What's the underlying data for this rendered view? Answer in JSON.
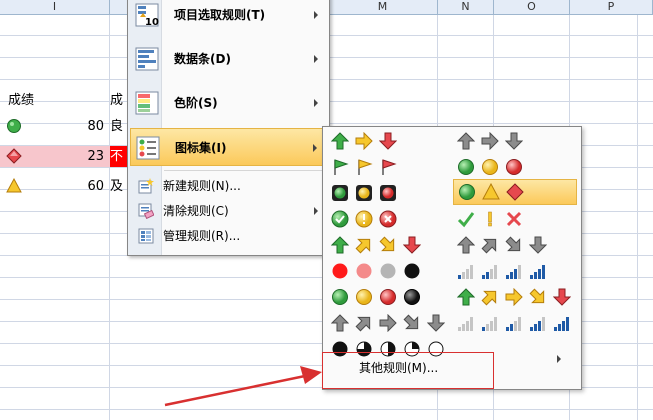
{
  "columns": [
    "I",
    "M",
    "N",
    "O",
    "P"
  ],
  "cells": {
    "header_score": "成绩",
    "header_partial": "成",
    "row1_value": "80",
    "row1_grade": "良",
    "row2_value": "23",
    "row2_grade": "不",
    "row3_value": "60",
    "row3_grade": "及"
  },
  "colors": {
    "highlight_row": "#f7c6cc",
    "red_cell": "#ff0000",
    "menu_highlight": "#fbc95a",
    "annotation_red": "#d83030"
  },
  "main_menu": {
    "items": [
      {
        "label": "项目选取规则(T)",
        "icon": "top-bottom-rules-icon"
      },
      {
        "label": "数据条(D)",
        "icon": "data-bars-icon"
      },
      {
        "label": "色阶(S)",
        "icon": "color-scales-icon"
      },
      {
        "label": "图标集(I)",
        "icon": "icon-sets-icon"
      }
    ],
    "small_items": [
      {
        "label": "新建规则(N)...",
        "icon": "new-rule-icon"
      },
      {
        "label": "清除规则(C)",
        "icon": "clear-rules-icon"
      },
      {
        "label": "管理规则(R)...",
        "icon": "manage-rules-icon"
      }
    ]
  },
  "submenu": {
    "more_rules": "其他规则(M)...",
    "highlighted_set": "3-signs-symbols"
  },
  "icon_sets_left": [
    {
      "name": "3-arrows-colored",
      "icons": [
        "arrow-up-green",
        "arrow-right-yellow",
        "arrow-down-red"
      ]
    },
    {
      "name": "3-flags",
      "icons": [
        "flag-green",
        "flag-yellow",
        "flag-red"
      ]
    },
    {
      "name": "3-traffic-lights-rimmed",
      "icons": [
        "light-green",
        "light-yellow",
        "light-red"
      ]
    },
    {
      "name": "3-symbols-circled",
      "icons": [
        "check-circle",
        "exclaim-circle",
        "x-circle"
      ]
    },
    {
      "name": "4-arrows-colored",
      "icons": [
        "arrow-up-green",
        "arrow-ne-yellow",
        "arrow-se-yellow",
        "arrow-down-red"
      ]
    },
    {
      "name": "red-to-black",
      "icons": [
        "dot-red",
        "dot-pink",
        "dot-gray",
        "dot-black"
      ]
    },
    {
      "name": "4-traffic-lights",
      "icons": [
        "dot-green",
        "dot-yellow",
        "dot-red",
        "dot-black"
      ]
    },
    {
      "name": "5-arrows-gray",
      "icons": [
        "arrow-up-gray",
        "arrow-ne-gray",
        "arrow-right-gray",
        "arrow-se-gray",
        "arrow-down-gray"
      ]
    },
    {
      "name": "5-quarters",
      "icons": [
        "quarter-4",
        "quarter-3",
        "quarter-2",
        "quarter-1",
        "quarter-0"
      ]
    }
  ],
  "icon_sets_right": [
    {
      "name": "3-arrows-gray",
      "icons": [
        "arrow-up-gray",
        "arrow-right-gray",
        "arrow-down-gray"
      ]
    },
    {
      "name": "3-traffic-lights",
      "icons": [
        "dot-green",
        "dot-yellow",
        "dot-red"
      ]
    },
    {
      "name": "3-signs-symbols",
      "icons": [
        "circle-green",
        "triangle-yellow",
        "diamond-red"
      ]
    },
    {
      "name": "3-symbols",
      "icons": [
        "check-green",
        "exclaim-yellow",
        "x-red"
      ]
    },
    {
      "name": "4-arrows-gray",
      "icons": [
        "arrow-up-gray",
        "arrow-ne-gray",
        "arrow-se-gray",
        "arrow-down-gray"
      ]
    },
    {
      "name": "4-ratings",
      "icons": [
        "bars-1",
        "bars-2",
        "bars-3",
        "bars-4"
      ]
    },
    {
      "name": "5-arrows-colored",
      "icons": [
        "arrow-up-green",
        "arrow-ne-yellow",
        "arrow-right-yellow",
        "arrow-se-yellow",
        "arrow-down-red"
      ]
    },
    {
      "name": "5-ratings",
      "icons": [
        "bars-0",
        "bars-1",
        "bars-2",
        "bars-3",
        "bars-4"
      ]
    }
  ]
}
